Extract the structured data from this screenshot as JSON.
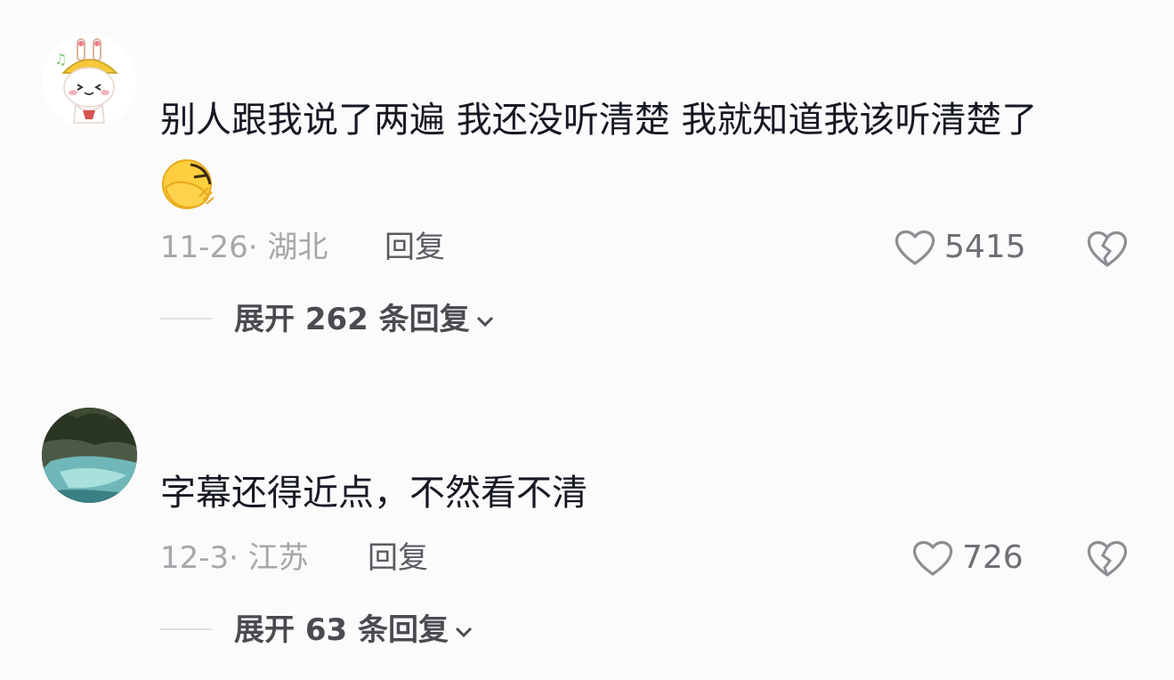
{
  "comments": [
    {
      "avatar": "cartoon-bunny-avatar",
      "text": "别人跟我说了两遍 我还没听清楚 我就知道我该听清楚了",
      "emoji": "facepalm-emoji",
      "date": "11-26·",
      "location": "湖北",
      "reply_label": "回复",
      "likes": "5415",
      "like_icon": "heart-outline-icon",
      "dislike_icon": "broken-heart-icon",
      "expand_label": "展开 262 条回复"
    },
    {
      "avatar": "waterfall-photo-avatar",
      "text": "字幕还得近点，不然看不清",
      "date": "12-3·",
      "location": "江苏",
      "reply_label": "回复",
      "likes": "726",
      "like_icon": "heart-outline-icon",
      "dislike_icon": "broken-heart-icon",
      "expand_label": "展开 63 条回复"
    }
  ],
  "colors": {
    "background": "#fbfbfb",
    "text": "#161823",
    "meta": "#a6a7ab",
    "expand": "#4a4b51"
  }
}
